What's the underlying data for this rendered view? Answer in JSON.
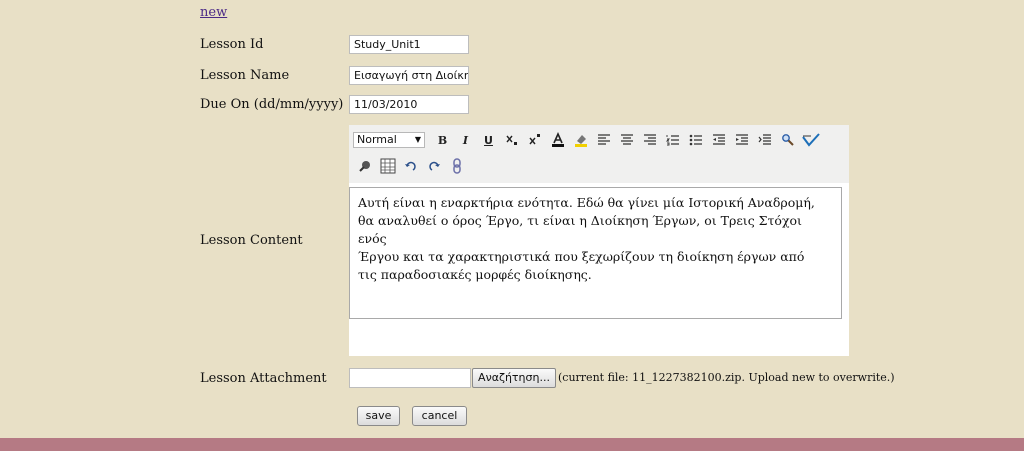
{
  "links": {
    "new": "new"
  },
  "form": {
    "lesson_id": {
      "label": "Lesson Id",
      "value": "Study_Unit1"
    },
    "lesson_name": {
      "label": "Lesson Name",
      "value": "Εισαγωγή στη Διοίκησ"
    },
    "due_on": {
      "label": "Due On (dd/mm/yyyy)",
      "value": "11/03/2010"
    },
    "content": {
      "label": "Lesson Content",
      "lines": [
        "Αυτή είναι η εναρκτήρια ενότητα. Εδώ θα γίνει μία Ιστορική Αναδρομή,",
        "θα αναλυθεί ο όρος Έργο, τι είναι η Διοίκηση Έργων, οι Τρεις Στόχοι ενός",
        "Έργου και τα χαρακτηριστικά που ξεχωρίζουν τη διοίκηση έργων από",
        "τις παραδοσιακές μορφές διοίκησης."
      ]
    },
    "attachment": {
      "label": "Lesson Attachment",
      "browse_label": "Αναζήτηση...",
      "current_file_text": "(current file: 11_1227382100.zip. Upload new to overwrite.)"
    }
  },
  "editor": {
    "format_value": "Normal",
    "toolbar_row1": [
      "bold",
      "italic",
      "underline",
      "subscript",
      "superscript",
      "font-color",
      "highlight",
      "align-left",
      "align-center",
      "align-right",
      "ordered-list",
      "unordered-list",
      "outdent",
      "indent",
      "increase-indent",
      "find",
      "spell-check"
    ],
    "toolbar_row2": [
      "remove-format",
      "table",
      "undo",
      "redo",
      "link"
    ],
    "glyphs": {
      "bold": "B",
      "italic": "I",
      "underline": "U"
    }
  },
  "buttons": {
    "save": "save",
    "cancel": "cancel"
  },
  "colors": {
    "background": "#e8e0c6",
    "bottom_bar": "#b57a84",
    "link": "#4b2a86"
  }
}
